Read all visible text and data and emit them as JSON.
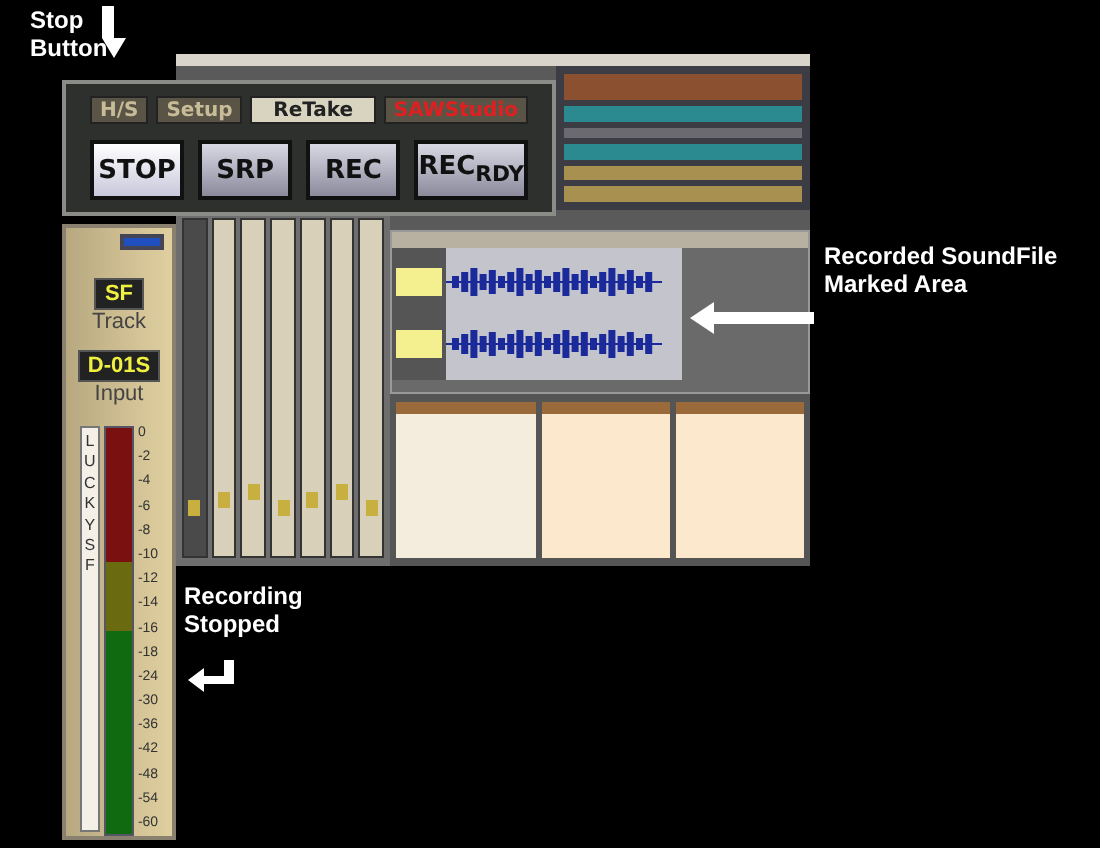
{
  "transport": {
    "tabs": [
      {
        "label": "H/S",
        "selected": false
      },
      {
        "label": "Setup",
        "selected": false
      },
      {
        "label": "ReTake",
        "selected": true
      }
    ],
    "brand": "SAWStudio",
    "buttons": [
      {
        "label": "STOP",
        "selected": true
      },
      {
        "label": "SRP",
        "selected": false
      },
      {
        "label": "REC",
        "selected": false
      },
      {
        "label": "REC",
        "sub": "RDY",
        "selected": false
      }
    ]
  },
  "meter_panel": {
    "toggle_on": true,
    "source": "SF",
    "track_label": "Track",
    "track": "D-01S",
    "input_label": "Input",
    "name": "LUCKY SF",
    "scale": [
      "0",
      "-2",
      "-4",
      "-6",
      "-8",
      "-10",
      "-12",
      "-14",
      "-16",
      "-18",
      "-24",
      "-30",
      "-36",
      "-42",
      "-48",
      "-54",
      "-60"
    ]
  },
  "callouts": [
    {
      "text": "Stop Button",
      "kind": "down"
    },
    {
      "text": "Recorded SoundFile Marked Area",
      "kind": "left"
    },
    {
      "text": "Recording Stopped",
      "kind": "return"
    }
  ]
}
